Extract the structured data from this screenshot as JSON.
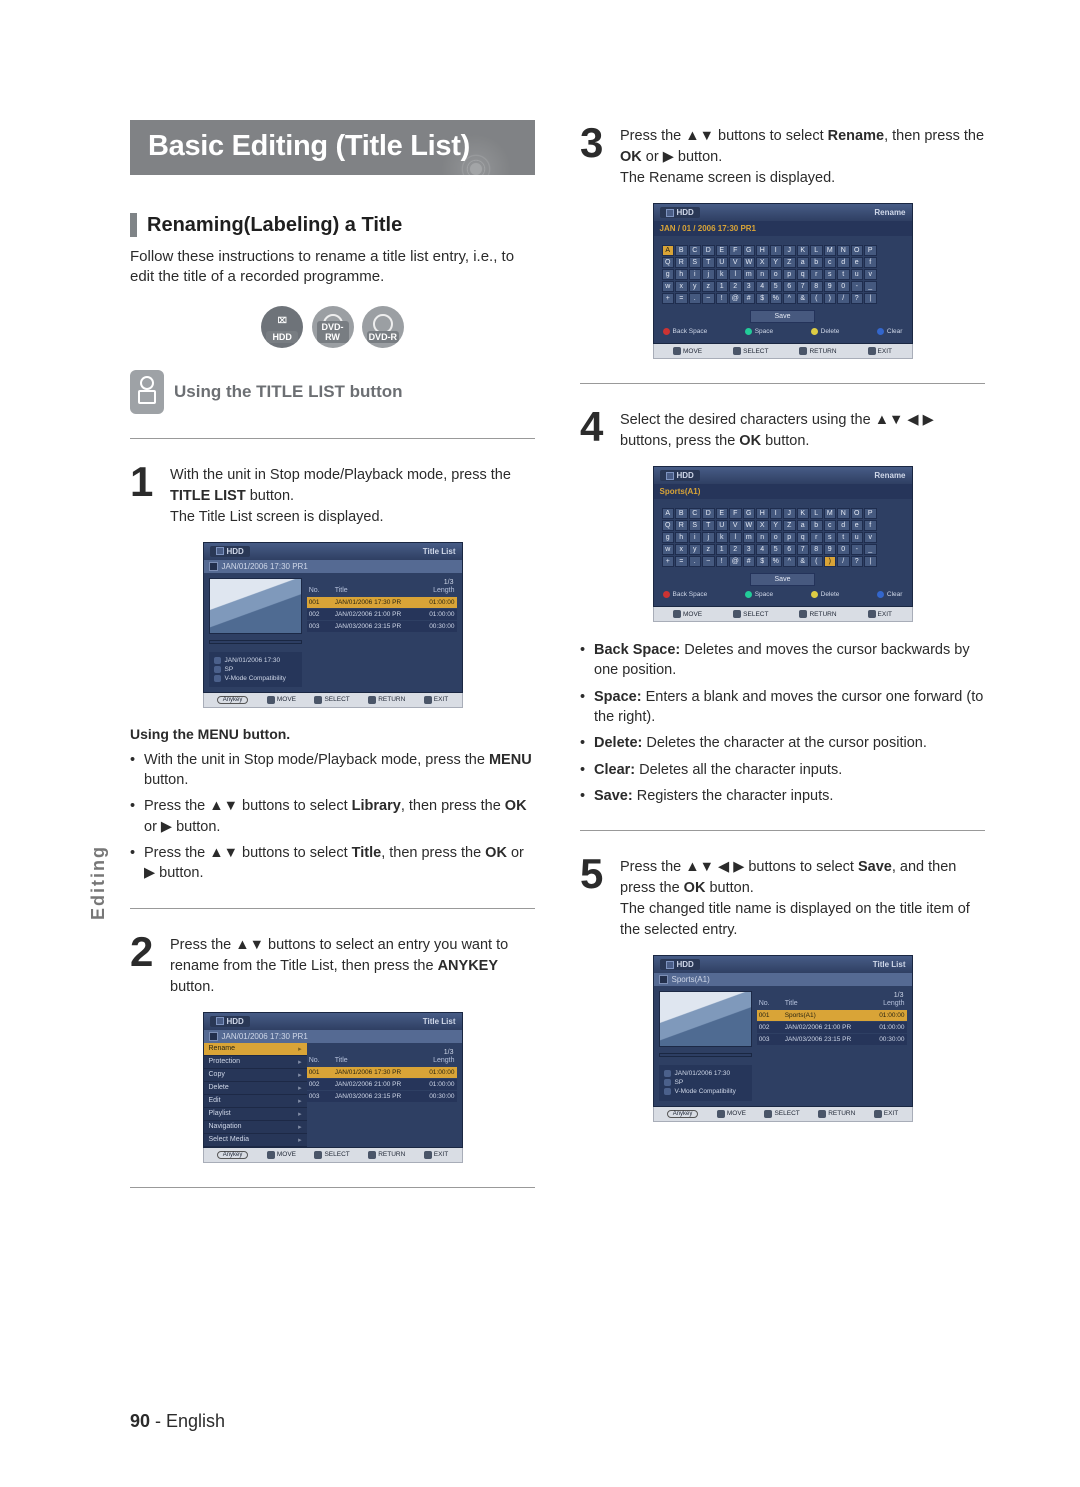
{
  "page": {
    "number": "90",
    "lang": "English",
    "side_label": "Editing"
  },
  "title": "Basic Editing (Title List)",
  "section1": {
    "heading": "Renaming(Labeling) a Title",
    "intro": "Follow these instructions to rename a title list entry, i.e., to edit the title of a recorded programme.",
    "badges": {
      "hdd": "HDD",
      "rw": "DVD-RW",
      "r": "DVD-R"
    },
    "sub_heading": "Using the TITLE LIST button"
  },
  "steps": {
    "s1": {
      "num": "1",
      "line1": "With the unit in Stop mode/Playback mode, press the ",
      "bold1": "TITLE LIST",
      "line1b": " button.",
      "line2": "The Title List screen is displayed."
    },
    "menu_heading": "Using the MENU button.",
    "menu_items": {
      "a_pre": "With the unit in Stop mode/Playback mode, press the ",
      "a_bold": "MENU",
      "a_post": " button.",
      "b_pre": "Press the ▲▼ buttons to select ",
      "b_bold": "Library",
      "b_post": ", then press the ",
      "b_bold2": "OK",
      "b_post2": " or ▶ button.",
      "c_pre": "Press the ▲▼ buttons to select ",
      "c_bold": "Title",
      "c_post": ", then press the ",
      "c_bold2": "OK",
      "c_post2": " or ▶ button."
    },
    "s2": {
      "num": "2",
      "pre": "Press the ▲▼ buttons to select an entry you want to rename from the Title List, then press the ",
      "bold": "ANYKEY",
      "post": " button."
    },
    "s3": {
      "num": "3",
      "pre": "Press the ▲▼ buttons to select ",
      "bold": "Rename",
      "mid": ", then press the ",
      "bold2": "OK",
      "post": " or ▶ button.",
      "line2": "The Rename screen is displayed."
    },
    "s4": {
      "num": "4",
      "pre": "Select the desired characters using the ▲▼ ◀ ▶ buttons, press the ",
      "bold": "OK",
      "post": " button."
    },
    "defs": {
      "bs": {
        "k": "Back Space:",
        "v": " Deletes and moves the cursor backwards by one position."
      },
      "sp": {
        "k": "Space:",
        "v": " Enters a blank and moves the cursor one forward (to the right)."
      },
      "del": {
        "k": "Delete:",
        "v": " Deletes the character at the cursor position."
      },
      "clr": {
        "k": "Clear:",
        "v": " Deletes all the character inputs."
      },
      "sv": {
        "k": "Save:",
        "v": " Registers the character inputs."
      }
    },
    "s5": {
      "num": "5",
      "pre": "Press the ▲▼ ◀ ▶ buttons to select ",
      "bold": "Save",
      "mid": ", and then press the ",
      "bold2": "OK",
      "post": " button.",
      "line2": "The changed title name is displayed on the title item of the selected entry."
    }
  },
  "osd_common": {
    "hdd": "HDD",
    "legend": {
      "anykey": "Anykey",
      "move": "MOVE",
      "select": "SELECT",
      "return": "RETURN",
      "exit": "EXIT"
    },
    "kb_legend": {
      "move": "MOVE",
      "select": "SELECT",
      "return": "RETURN",
      "exit": "EXIT"
    },
    "fn": {
      "bs": "Back Space",
      "sp": "Space",
      "del": "Delete",
      "clr": "Clear"
    }
  },
  "osd1": {
    "right": "Title List",
    "bar": "JAN/01/2006 17:30 PR1",
    "frac": "1/3",
    "hdr": {
      "no": "No.",
      "title": "Title",
      "len": "Length"
    },
    "rows": [
      {
        "no": "001",
        "title": "JAN/01/2006 17:30 PR",
        "len": "01:00:00"
      },
      {
        "no": "002",
        "title": "JAN/02/2006 21:00 PR",
        "len": "01:00:00"
      },
      {
        "no": "003",
        "title": "JAN/03/2006 23:15 PR",
        "len": "00:30:00"
      }
    ],
    "meta": {
      "a": "JAN/01/2006 17:30",
      "b": "SP",
      "c": "V-Mode Compatibility"
    }
  },
  "osd2": {
    "right": "Title List",
    "bar": "JAN/01/2006 17:30 PR1",
    "frac": "1/3",
    "menu": [
      "Rename",
      "Protection",
      "Copy",
      "Delete",
      "Edit",
      "Playlist",
      "Navigation",
      "Select Media"
    ],
    "hdr": {
      "no": "No.",
      "title": "Title",
      "len": "Length"
    },
    "rows": [
      {
        "no": "001",
        "title": "JAN/01/2006 17:30 PR",
        "len": "01:00:00"
      },
      {
        "no": "002",
        "title": "JAN/02/2006 21:00 PR",
        "len": "01:00:00"
      },
      {
        "no": "003",
        "title": "JAN/03/2006 23:15 PR",
        "len": "00:30:00"
      }
    ]
  },
  "kb1": {
    "right": "Rename",
    "title": "JAN / 01 / 2006  17:30  PR1",
    "rows": [
      [
        "A",
        "B",
        "C",
        "D",
        "E",
        "F",
        "G",
        "H",
        "I",
        "J",
        "K",
        "L",
        "M",
        "N",
        "O",
        "P"
      ],
      [
        "Q",
        "R",
        "S",
        "T",
        "U",
        "V",
        "W",
        "X",
        "Y",
        "Z",
        "a",
        "b",
        "c",
        "d",
        "e",
        "f"
      ],
      [
        "g",
        "h",
        "i",
        "j",
        "k",
        "l",
        "m",
        "n",
        "o",
        "p",
        "q",
        "r",
        "s",
        "t",
        "u",
        "v"
      ],
      [
        "w",
        "x",
        "y",
        "z",
        "1",
        "2",
        "3",
        "4",
        "5",
        "6",
        "7",
        "8",
        "9",
        "0",
        "-",
        "_"
      ],
      [
        "+",
        "=",
        ".",
        "~",
        "!",
        "@",
        "#",
        "$",
        "%",
        "^",
        "&",
        "(",
        ")",
        "/",
        "?",
        "|"
      ]
    ],
    "save": "Save",
    "sel": "A"
  },
  "kb2": {
    "right": "Rename",
    "title": "Sports(A1)",
    "rows": [
      [
        "A",
        "B",
        "C",
        "D",
        "E",
        "F",
        "G",
        "H",
        "I",
        "J",
        "K",
        "L",
        "M",
        "N",
        "O",
        "P"
      ],
      [
        "Q",
        "R",
        "S",
        "T",
        "U",
        "V",
        "W",
        "X",
        "Y",
        "Z",
        "a",
        "b",
        "c",
        "d",
        "e",
        "f"
      ],
      [
        "g",
        "h",
        "i",
        "j",
        "k",
        "l",
        "m",
        "n",
        "o",
        "p",
        "q",
        "r",
        "s",
        "t",
        "u",
        "v"
      ],
      [
        "w",
        "x",
        "y",
        "z",
        "1",
        "2",
        "3",
        "4",
        "5",
        "6",
        "7",
        "8",
        "9",
        "0",
        "-",
        "_"
      ],
      [
        "+",
        "=",
        ".",
        "~",
        "!",
        "@",
        "#",
        "$",
        "%",
        "^",
        "&",
        "(",
        ")",
        "/",
        "?",
        "|"
      ]
    ],
    "save": "Save",
    "sel": ")"
  },
  "osd5": {
    "right": "Title List",
    "bar": "Sports(A1)",
    "frac": "1/3",
    "hdr": {
      "no": "No.",
      "title": "Title",
      "len": "Length"
    },
    "rows": [
      {
        "no": "001",
        "title": "Sports(A1)",
        "len": "01:00:00"
      },
      {
        "no": "002",
        "title": "JAN/02/2006 21:00 PR",
        "len": "01:00:00"
      },
      {
        "no": "003",
        "title": "JAN/03/2006 23:15 PR",
        "len": "00:30:00"
      }
    ],
    "meta": {
      "a": "JAN/01/2006 17:30",
      "b": "SP",
      "c": "V-Mode Compatibility"
    }
  }
}
